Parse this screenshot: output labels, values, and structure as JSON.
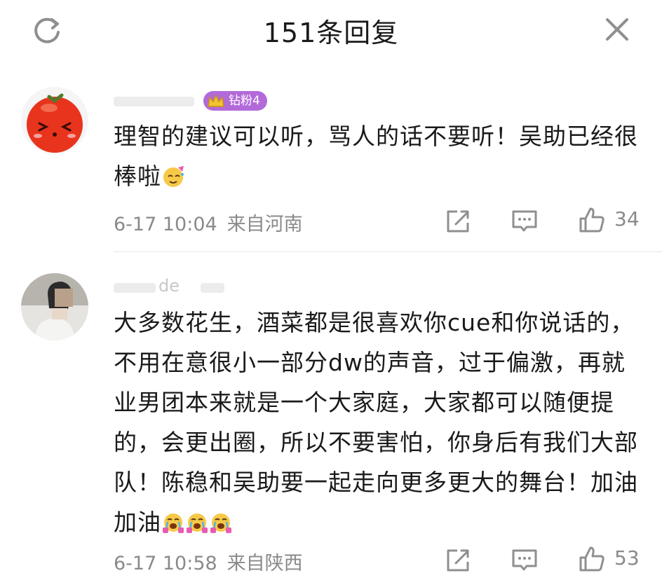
{
  "header": {
    "title": "151条回复",
    "refresh_icon": "refresh-icon",
    "close_icon": "close-icon"
  },
  "comments": [
    {
      "avatar_icon": "tomato-avatar",
      "badge": "钻粉4",
      "text": "理智的建议可以听，骂人的话不要听！吴助已经很棒啦",
      "emoji_icon": "party-face-emoji",
      "time": "6-17 10:04",
      "location": "来自河南",
      "likes": "34"
    },
    {
      "avatar_icon": "person-avatar",
      "nickname_fragment": "de",
      "text": "大多数花生，酒菜都是很喜欢你cue和你说话的，不用在意很小一部分dw的声音，过于偏激，再就业男团本来就是一个大家庭，大家都可以随便提的，会更出圈，所以不要害怕，你身后有我们大部队！陈稳和吴助要一起走向更多更大的舞台！加油加油",
      "emoji_icon": "crying-cheer-emoji",
      "time": "6-17 10:58",
      "location": "来自陕西",
      "likes": "53"
    }
  ],
  "colors": {
    "text": "#1a1a1a",
    "meta": "#8a8a8a",
    "badge": "#b26ad9",
    "icon": "#8f8f8f"
  }
}
